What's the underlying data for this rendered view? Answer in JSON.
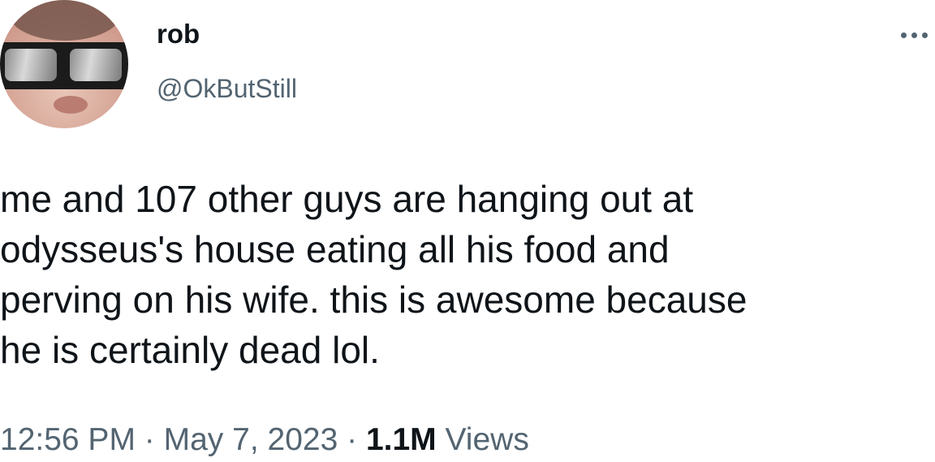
{
  "user": {
    "display_name": "rob",
    "handle": "@OkButStill"
  },
  "tweet": {
    "lines": [
      "me and 107 other guys are hanging out at",
      "odysseus's house eating all his food and",
      "perving on his wife. this is awesome because",
      "he is certainly dead lol."
    ]
  },
  "meta": {
    "time": "12:56 PM",
    "separator": "·",
    "date": "May 7, 2023",
    "views_count": "1.1M",
    "views_label": "Views"
  },
  "icons": {
    "more": "more-options-icon"
  },
  "colors": {
    "text": "#0f1419",
    "secondary": "#536471",
    "background": "#ffffff"
  }
}
